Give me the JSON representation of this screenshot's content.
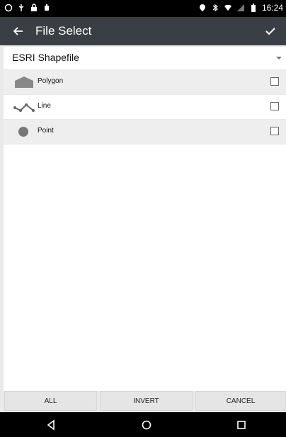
{
  "status_bar": {
    "time": "16:24",
    "left_icons": [
      "circle-icon",
      "usb-icon",
      "lock-icon",
      "android-icon"
    ],
    "right_icons": [
      "location-icon",
      "bluetooth-icon",
      "wifi-icon",
      "signal-icon",
      "battery-icon"
    ]
  },
  "app_bar": {
    "title": "File Select",
    "back_icon": "arrow-left-icon",
    "done_icon": "check-icon"
  },
  "format": {
    "selected": "ESRI Shapefile",
    "dropdown_icon": "triangle-down-icon"
  },
  "list": {
    "items": [
      {
        "label": "Polygon",
        "icon": "polygon-icon",
        "checked": false
      },
      {
        "label": "Line",
        "icon": "line-icon",
        "checked": false
      },
      {
        "label": "Point",
        "icon": "point-icon",
        "checked": false
      }
    ]
  },
  "buttons": {
    "all": "ALL",
    "invert": "INVERT",
    "cancel": "CANCEL"
  },
  "nav": {
    "back": "back-triangle-icon",
    "home": "home-circle-icon",
    "recent": "recent-square-icon"
  },
  "colors": {
    "app_bar_bg": "#3a3f45",
    "status_bg": "#000000",
    "shaded_row": "#eeeeee"
  }
}
